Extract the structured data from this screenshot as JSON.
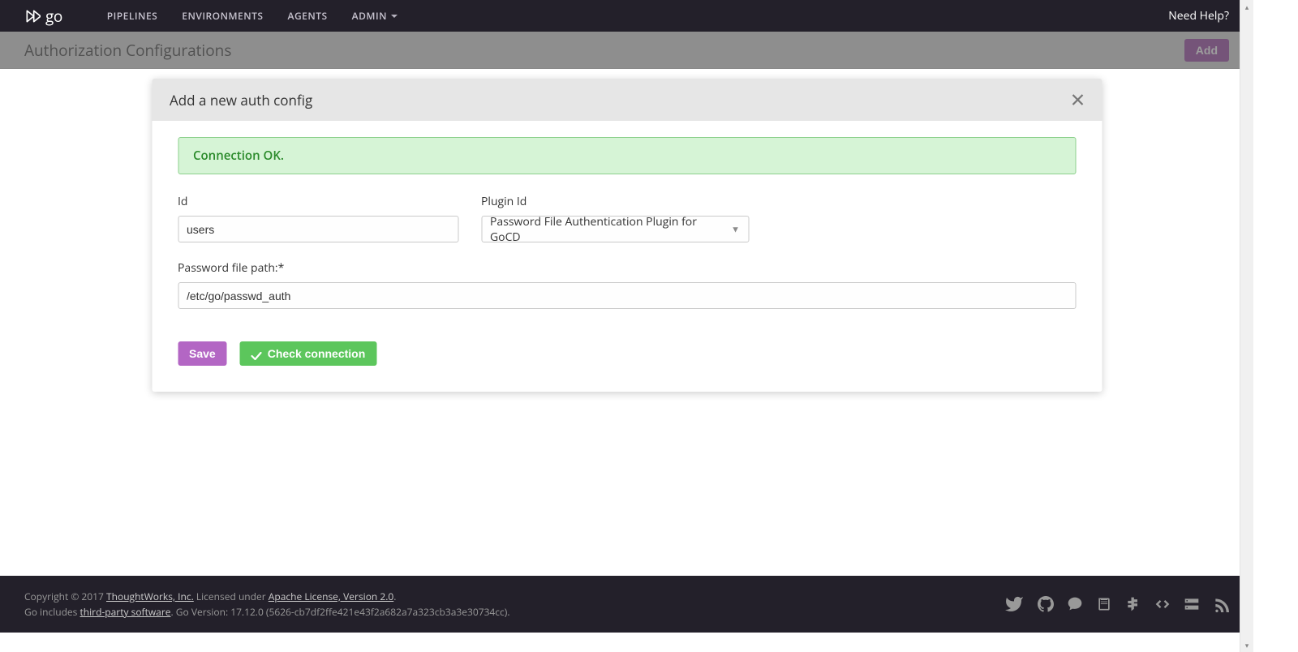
{
  "header": {
    "logo_text": "go",
    "nav": [
      "PIPELINES",
      "ENVIRONMENTS",
      "AGENTS",
      "ADMIN"
    ],
    "help": "Need Help?"
  },
  "page": {
    "title": "Authorization Configurations",
    "add_button": "Add"
  },
  "modal": {
    "title": "Add a new auth config",
    "alert": "Connection OK.",
    "fields": {
      "id_label": "Id",
      "id_value": "users",
      "plugin_label": "Plugin Id",
      "plugin_selected": "Password File Authentication Plugin for GoCD",
      "path_label": "Password file path:*",
      "path_value": "/etc/go/passwd_auth"
    },
    "buttons": {
      "save": "Save",
      "check": "Check connection"
    }
  },
  "footer": {
    "line1_prefix": "Copyright © 2017 ",
    "line1_link1": "ThoughtWorks, Inc.",
    "line1_mid": " Licensed under ",
    "line1_link2": "Apache License, Version 2.0",
    "line1_suffix": ".",
    "line2_prefix": "Go includes ",
    "line2_link": "third-party software",
    "line2_suffix": ". Go Version: 17.12.0 (5626-cb7df2ffe421e43f2a682a7a323cb3a3e30734cc)."
  }
}
